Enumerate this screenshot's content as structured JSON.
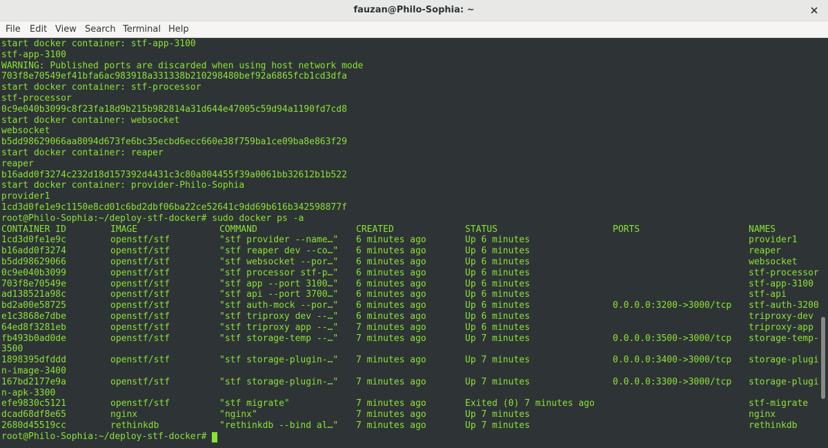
{
  "window": {
    "title": "fauzan@Philo-Sophia: ~"
  },
  "menu": [
    "File",
    "Edit",
    "View",
    "Search",
    "Terminal",
    "Help"
  ],
  "terminal": {
    "log_lines": [
      "start docker container: stf-app-3100",
      "stf-app-3100",
      "WARNING: Published ports are discarded when using host network mode",
      "703f8e70549ef41bfa6ac983918a331338b210298480bef92a6865fcb1cd3dfa",
      "start docker container: stf-processor",
      "stf-processor",
      "0c9e040b3099c8f23fa18d9b215b982814a31d644e47005c59d94a1190fd7cd8",
      "start docker container: websocket",
      "websocket",
      "b5dd98629066aa8094d673fe6bc35ecbd6ecc660e38f759ba1ce09ba8e863f29",
      "start docker container: reaper",
      "reaper",
      "b16add0f3274c232d18d157392d4431c3c80a804455f39a0061bb32612b1b522",
      "start docker container: provider-Philo-Sophia",
      "provider1",
      "1cd3d0fe1e9c1150e8cd01c6bd2dbf06ba22ce52641c9dd69b616b342598877f"
    ],
    "command_line": "root@Philo-Sophia:~/deploy-stf-docker# sudo docker ps -a",
    "table_headers": [
      "CONTAINER ID",
      "IMAGE",
      "COMMAND",
      "CREATED",
      "STATUS",
      "PORTS",
      "NAMES"
    ],
    "table_rows": [
      [
        "1cd3d0fe1e9c",
        "openstf/stf",
        "\"stf provider --name…\"",
        "6 minutes ago",
        "Up 6 minutes",
        "",
        "provider1"
      ],
      [
        "b16add0f3274",
        "openstf/stf",
        "\"stf reaper dev --co…\"",
        "6 minutes ago",
        "Up 6 minutes",
        "",
        "reaper"
      ],
      [
        "b5dd98629066",
        "openstf/stf",
        "\"stf websocket --por…\"",
        "6 minutes ago",
        "Up 6 minutes",
        "",
        "websocket"
      ],
      [
        "0c9e040b3099",
        "openstf/stf",
        "\"stf processor stf-p…\"",
        "6 minutes ago",
        "Up 6 minutes",
        "",
        "stf-processor"
      ],
      [
        "703f8e70549e",
        "openstf/stf",
        "\"stf app --port 3100…\"",
        "6 minutes ago",
        "Up 6 minutes",
        "",
        "stf-app-3100"
      ],
      [
        "ad138521a98c",
        "openstf/stf",
        "\"stf api --port 3700…\"",
        "6 minutes ago",
        "Up 6 minutes",
        "",
        "stf-api"
      ],
      [
        "bd2a00e58725",
        "openstf/stf",
        "\"stf auth-mock --por…\"",
        "6 minutes ago",
        "Up 6 minutes",
        "0.0.0.0:3200->3000/tcp",
        "stf-auth-3200"
      ],
      [
        "e1c3868e7dbe",
        "openstf/stf",
        "\"stf triproxy dev --…\"",
        "6 minutes ago",
        "Up 6 minutes",
        "",
        "triproxy-dev"
      ],
      [
        "64ed8f3281eb",
        "openstf/stf",
        "\"stf triproxy app --…\"",
        "7 minutes ago",
        "Up 6 minutes",
        "",
        "triproxy-app"
      ],
      [
        "fb493b0ad0de",
        "openstf/stf",
        "\"stf storage-temp --…\"",
        "7 minutes ago",
        "Up 7 minutes",
        "0.0.0.0:3500->3000/tcp",
        "storage-temp-"
      ],
      [
        "3500",
        "",
        "",
        "",
        "",
        "",
        ""
      ],
      [
        "1898395dfddd",
        "openstf/stf",
        "\"stf storage-plugin-…\"",
        "7 minutes ago",
        "Up 7 minutes",
        "0.0.0.0:3400->3000/tcp",
        "storage-plugi"
      ],
      [
        "n-image-3400",
        "",
        "",
        "",
        "",
        "",
        ""
      ],
      [
        "167bd2177e9a",
        "openstf/stf",
        "\"stf storage-plugin-…\"",
        "7 minutes ago",
        "Up 7 minutes",
        "0.0.0.0:3300->3000/tcp",
        "storage-plugi"
      ],
      [
        "n-apk-3300",
        "",
        "",
        "",
        "",
        "",
        ""
      ],
      [
        "efe9830c5121",
        "openstf/stf",
        "\"stf migrate\"",
        "7 minutes ago",
        "Exited (0) 7 minutes ago",
        "",
        "stf-migrate"
      ],
      [
        "dcad68df8e65",
        "nginx",
        "\"nginx\"",
        "7 minutes ago",
        "Up 7 minutes",
        "",
        "nginx"
      ],
      [
        "2680d45519cc",
        "rethinkdb",
        "\"rethinkdb --bind al…\"",
        "7 minutes ago",
        "Up 7 minutes",
        "",
        "rethinkdb"
      ]
    ],
    "prompt": "root@Philo-Sophia:~/deploy-stf-docker# ",
    "scrollbar_position": 0.85,
    "scrollbar_visible_fraction": 0.2
  },
  "colors": {
    "terminal_text": "#8ae234",
    "terminal_background": "#2e3436"
  }
}
